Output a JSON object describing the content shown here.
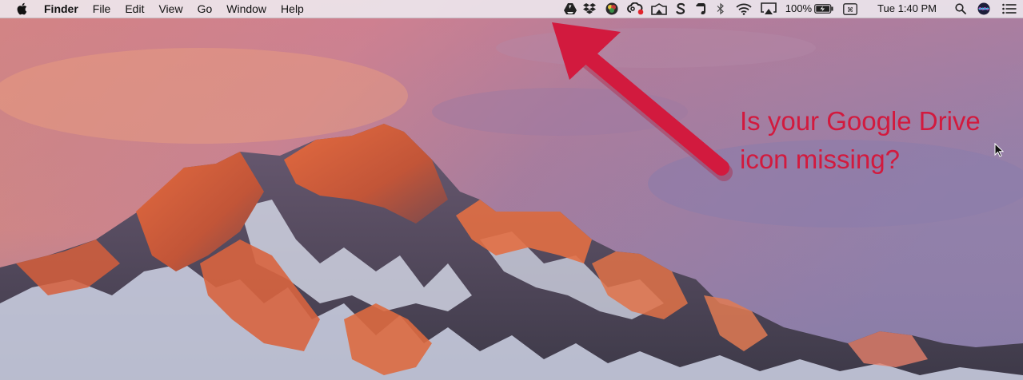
{
  "menubar": {
    "app_name": "Finder",
    "menus": [
      "File",
      "Edit",
      "View",
      "Go",
      "Window",
      "Help"
    ],
    "battery_percent": "100%",
    "clock": "Tue 1:40 PM",
    "status_icons": [
      "google-drive-icon",
      "dropbox-icon",
      "colorsync-icon",
      "creative-cloud-icon",
      "screen-mirroring-icon",
      "skype-icon",
      "evernote-icon",
      "bluetooth-icon",
      "wifi-icon",
      "airplay-icon",
      "battery-icon",
      "keyboard-icon",
      "spotlight-icon",
      "siri-icon",
      "notification-center-icon"
    ]
  },
  "annotation": {
    "line1": "Is your Google Drive",
    "line2": "icon missing?",
    "color": "#d21a3e"
  },
  "wallpaper": {
    "description": "macOS Sierra mountain wallpaper",
    "sky_colors": [
      "#e8836c",
      "#b56e8e",
      "#8a78a8"
    ],
    "rock_color": "#d96a43",
    "snow_color": "#d8dceb"
  }
}
